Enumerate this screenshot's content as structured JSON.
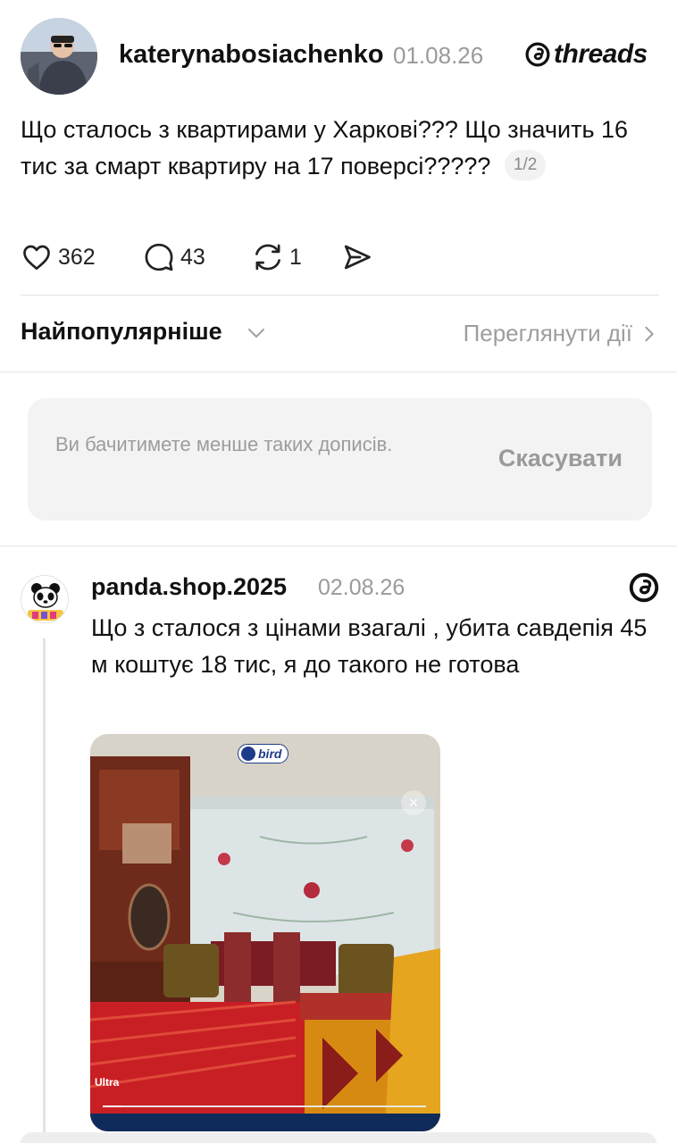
{
  "post": {
    "username": "katerynabosiachenko",
    "date": "01.08.26",
    "brand": "threads",
    "text": "Що сталось з квартирами у Харкові??? Що значить 16 тис за смарт квартиру на 17 поверсі?????",
    "page_indicator": "1/2",
    "likes": "362",
    "comments": "43",
    "reposts": "1"
  },
  "sort": {
    "label": "Найпопулярніше",
    "view_activity": "Переглянути дії"
  },
  "notice": {
    "text": "Ви бачитимете менше таких дописів.",
    "cancel_label": "Скасувати"
  },
  "reply": {
    "username": "panda.shop.2025",
    "date": "02.08.26",
    "text": "Що з сталося з цінами взагалі , убита савдепія 45 м коштує 18 тис, я до такого не готова",
    "image": {
      "badge": "bird",
      "caption": "Ultra",
      "close": "×"
    }
  },
  "colors": {
    "text": "#111111",
    "muted": "#9a9a9a",
    "divider": "#e3e3e3",
    "notice_bg": "#f3f3f3"
  },
  "icons": [
    "heart-icon",
    "comment-icon",
    "repost-icon",
    "share-icon",
    "chevron-down-icon",
    "chevron-right-icon",
    "threads-logo-icon",
    "close-icon"
  ]
}
